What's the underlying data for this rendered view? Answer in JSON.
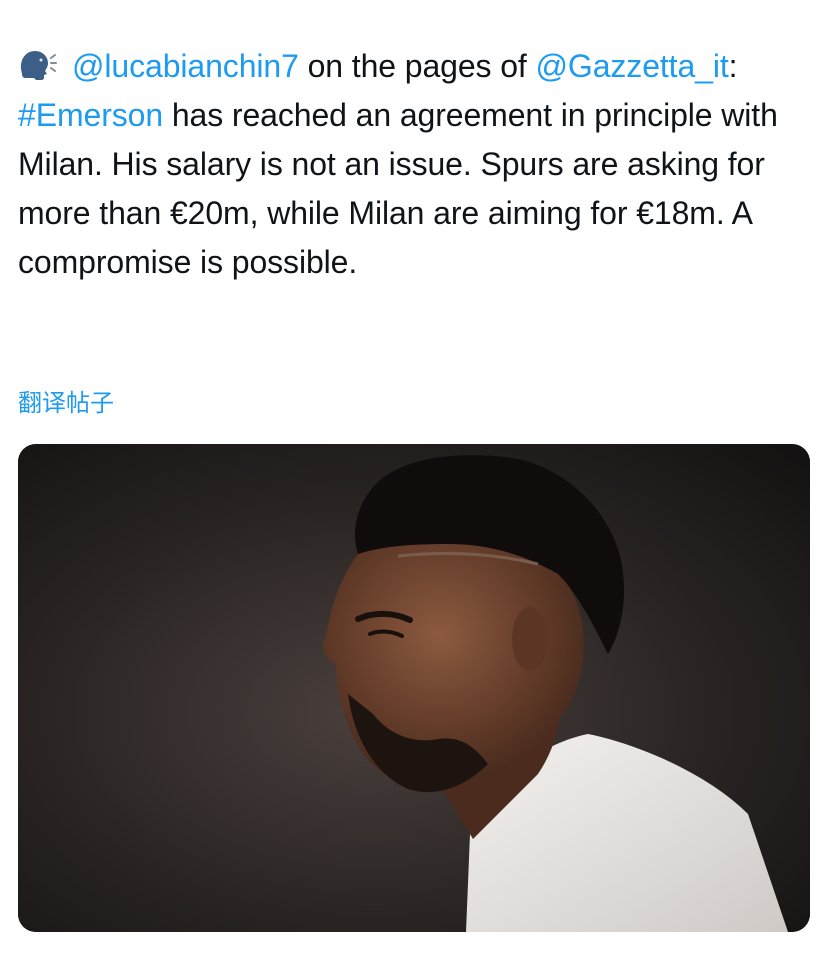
{
  "tweet": {
    "icon": "speaking-head-icon",
    "mention_1": "@lucabianchin7",
    "text_1": " on the pages of ",
    "mention_2": "@Gazzetta_it",
    "text_2": ": ",
    "hashtag": "#Emerson",
    "text_3": " has reached an agreement in principle with Milan. His salary is not an issue. Spurs are asking for more than €20m, while Milan are aiming for €18m. A compromise is possible."
  },
  "translate_label": "翻译帖子",
  "media": {
    "icon": "player-photo"
  },
  "colors": {
    "link": "#1d9bf0",
    "text": "#0f1419",
    "background": "#ffffff"
  }
}
